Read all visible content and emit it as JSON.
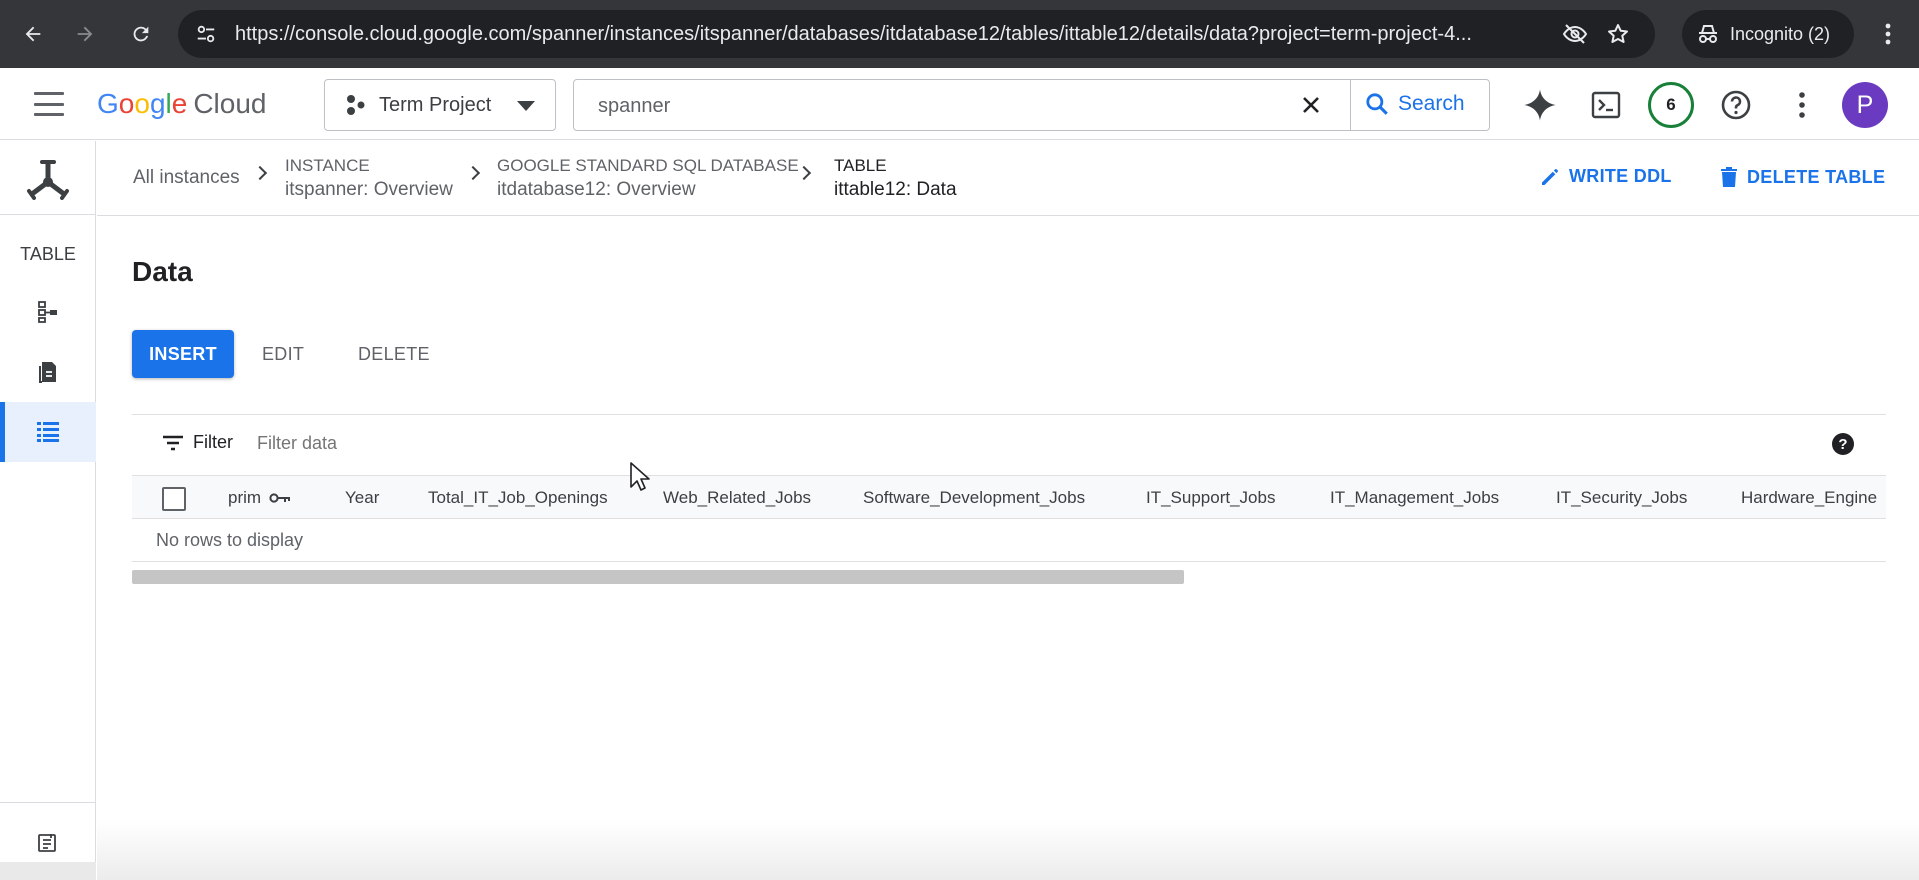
{
  "browser": {
    "url": "https://console.cloud.google.com/spanner/instances/itspanner/databases/itdatabase12/tables/ittable12/details/data?project=term-project-4...",
    "incognito_label": "Incognito (2)"
  },
  "header": {
    "logo_google": [
      "G",
      "o",
      "o",
      "g",
      "l",
      "e"
    ],
    "logo_cloud": "Cloud",
    "project_name": "Term Project",
    "search_value": "spanner",
    "search_button": "Search",
    "notifications_count": "6",
    "avatar_letter": "P"
  },
  "rail": {
    "section_label": "TABLE",
    "items": [
      {
        "icon": "schema-icon",
        "active": false
      },
      {
        "icon": "indexes-icon",
        "active": false
      },
      {
        "icon": "data-grid-icon",
        "active": true
      }
    ],
    "bottom_icon": "release-notes-icon"
  },
  "breadcrumb": {
    "all_instances": "All instances",
    "instance": {
      "kind": "INSTANCE",
      "value": "itspanner: Overview"
    },
    "database": {
      "kind": "GOOGLE STANDARD SQL DATABASE",
      "value": "itdatabase12: Overview"
    },
    "table": {
      "kind": "TABLE",
      "value": "ittable12: Data"
    },
    "write_ddl": "WRITE DDL",
    "delete_table": "DELETE TABLE"
  },
  "main": {
    "title": "Data",
    "buttons": {
      "insert": "INSERT",
      "edit": "EDIT",
      "delete": "DELETE"
    },
    "filter_label": "Filter",
    "filter_placeholder": "Filter data",
    "help": "?",
    "columns": [
      "prim",
      "Year",
      "Total_IT_Job_Openings",
      "Web_Related_Jobs",
      "Software_Development_Jobs",
      "IT_Support_Jobs",
      "IT_Management_Jobs",
      "IT_Security_Jobs",
      "Hardware_Engine"
    ],
    "empty_message": "No rows to display"
  },
  "colors": {
    "accent": "#1a73e8",
    "chrome_bg": "#35363a",
    "avatar": "#6a3bc0",
    "badge_ring": "#188038"
  }
}
